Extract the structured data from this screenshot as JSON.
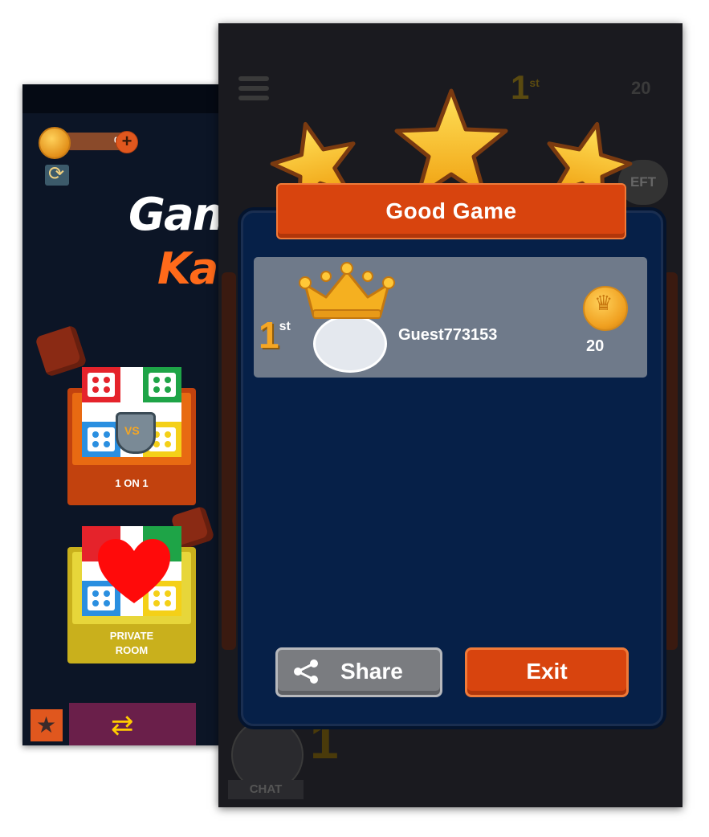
{
  "back_screen": {
    "coin_balance": "0",
    "logo_line1": "Gam",
    "logo_line2": "Ka",
    "modes": [
      {
        "label": "1 ON 1",
        "badge": "VS"
      },
      {
        "label_line1": "PRIVATE",
        "label_line2": "ROOM"
      }
    ],
    "icons": [
      "coin-icon",
      "plus-icon",
      "refresh-icon",
      "crown-icon",
      "heart-icon",
      "star-icon",
      "swap-arrows-icon"
    ]
  },
  "front_screen": {
    "top_rank": "1",
    "top_rank_suffix": "st",
    "top_score": "20",
    "left_button": "EFT",
    "bottom_rank": "1",
    "chat_label": "CHAT",
    "dialog": {
      "title": "Good Game",
      "stars": 3,
      "player": {
        "rank": "1",
        "rank_suffix": "st",
        "name": "Guest773153",
        "reward": "20"
      },
      "share_label": "Share",
      "exit_label": "Exit"
    }
  },
  "colors": {
    "dialog_bg": "#062048",
    "banner_orange": "#d8440e",
    "player_row": "#6f7a8a",
    "gold": "#f5a623",
    "share_gray": "#7a7c80"
  }
}
